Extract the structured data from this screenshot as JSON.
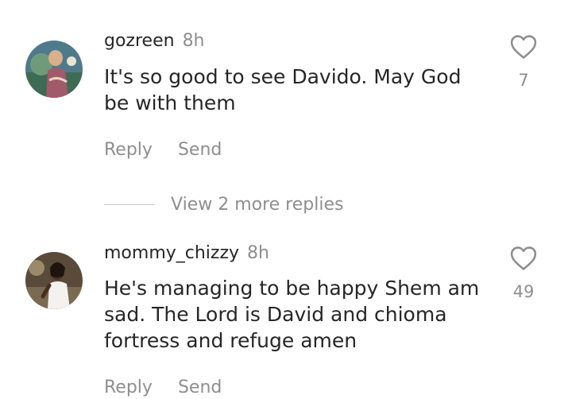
{
  "comments": [
    {
      "username": "gozreen",
      "time": "8h",
      "text": "It's so good to see Davido. May God be with them",
      "likes": "7",
      "reply_label": "Reply",
      "send_label": "Send"
    },
    {
      "username": "mommy_chizzy",
      "time": "8h",
      "text": "He's managing to be happy Shem am sad. The Lord is David and chioma fortress and refuge  amen",
      "likes": "49",
      "reply_label": "Reply",
      "send_label": "Send"
    }
  ],
  "view_more": {
    "label": "View 2 more replies"
  },
  "icons": {
    "like": "heart-outline-icon"
  },
  "colors": {
    "text_primary": "#262626",
    "text_secondary": "#8e8e8e",
    "divider": "#c7c7c7"
  }
}
